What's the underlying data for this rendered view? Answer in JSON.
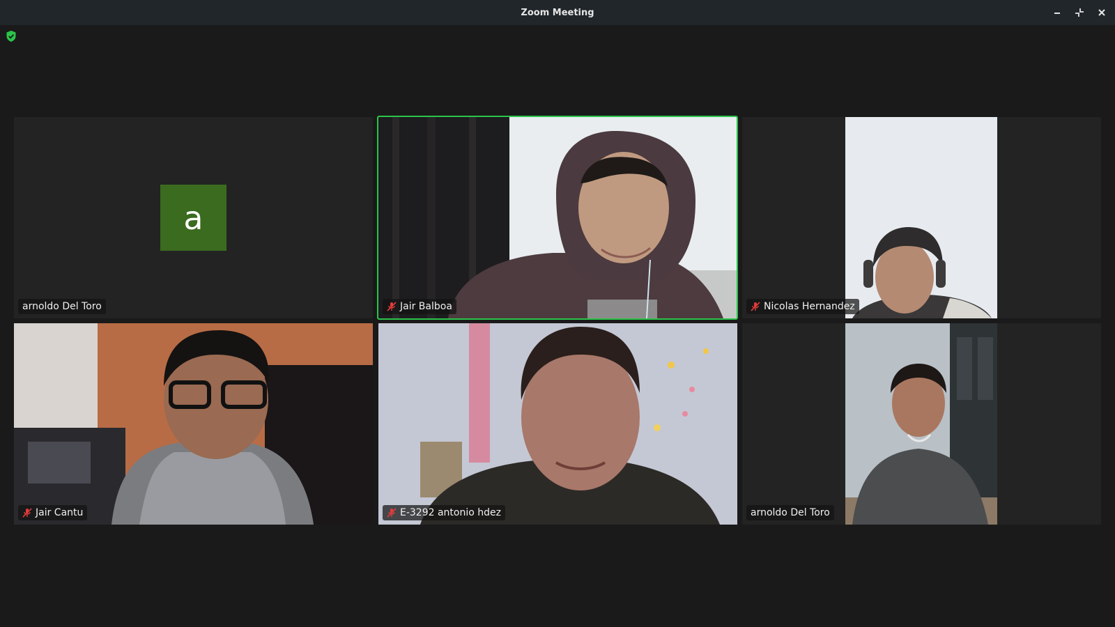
{
  "window": {
    "title": "Zoom Meeting",
    "controls": [
      "minimize-icon",
      "restore-icon",
      "close-icon"
    ]
  },
  "security": {
    "icon": "shield-check-icon",
    "color": "#2bc44a"
  },
  "active_speaker_color": "#2bc44a",
  "participants": [
    {
      "name": "arnoldo Del Toro",
      "muted": false,
      "video": false,
      "avatar_letter": "a",
      "avatar_color": "#3b6b1e"
    },
    {
      "name": "Jair Balboa",
      "muted": true,
      "video": true,
      "active_speaker": true
    },
    {
      "name": "Nicolas Hernandez",
      "muted": true,
      "video": true
    },
    {
      "name": "Jair Cantu",
      "muted": true,
      "video": true
    },
    {
      "name": "E-3292 antonio hdez",
      "muted": true,
      "video": true
    },
    {
      "name": "arnoldo Del Toro",
      "muted": false,
      "video": true
    }
  ]
}
